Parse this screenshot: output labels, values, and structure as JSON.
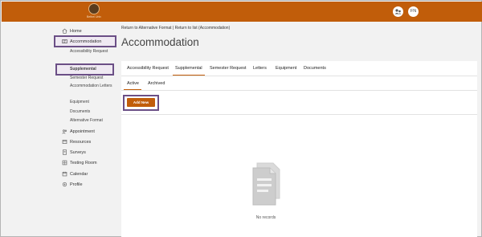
{
  "header": {
    "logo_text": "Bethel Univ",
    "icon_right_1": "people-icon",
    "user_initials": "FN",
    "brand_color": "#c15d0a"
  },
  "sidebar": {
    "items": [
      {
        "label": "Home",
        "icon": "home-icon"
      },
      {
        "label": "Accommodation",
        "icon": "accommodation-icon"
      },
      {
        "label": "Appointment",
        "icon": "appointment-icon"
      },
      {
        "label": "Resources",
        "icon": "resources-icon"
      },
      {
        "label": "Surveys",
        "icon": "surveys-icon"
      },
      {
        "label": "Testing Room",
        "icon": "testing-room-icon"
      },
      {
        "label": "Calendar",
        "icon": "calendar-icon"
      },
      {
        "label": "Profile",
        "icon": "profile-icon"
      }
    ],
    "sub_items": [
      "Accessibility Request",
      "Supplemental",
      "Semester Request",
      "Accommodation Letters",
      "Equipment",
      "Documents",
      "Alternative Format"
    ]
  },
  "breadcrumb": "Return to Alternative Format | Return to list (Accommodation)",
  "page_title": "Accommodation",
  "tabs": [
    "Accessibility Request",
    "Supplemental",
    "Semester Request",
    "Letters",
    "Equipment",
    "Documents"
  ],
  "active_tab": "Supplemental",
  "subtabs": [
    "Active",
    "Archived"
  ],
  "active_subtab": "Active",
  "add_button": "Add New",
  "empty_state": "No records",
  "highlight_color": "#6b4f86"
}
